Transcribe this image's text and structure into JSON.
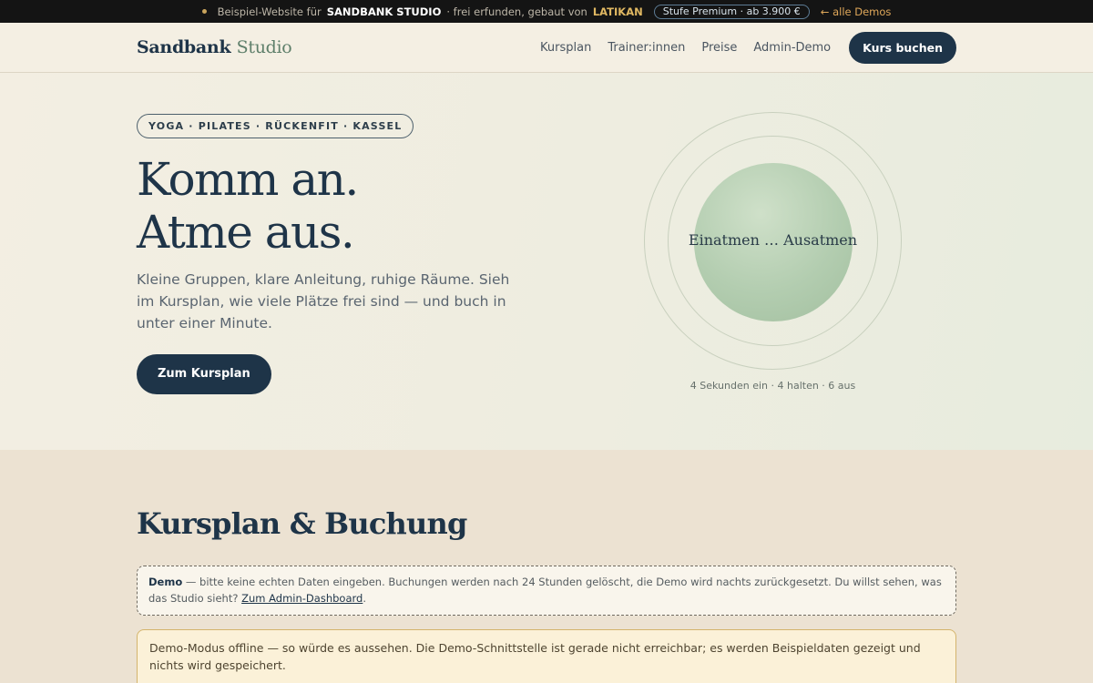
{
  "demobar": {
    "prefix": "Beispiel-Website für",
    "studio": "SANDBANK STUDIO",
    "middle": "· frei erfunden, gebaut von",
    "builder": "LATIKAN",
    "tier": "Stufe Premium · ab 3.900 €",
    "back": "← alle Demos"
  },
  "header": {
    "logo_main": "Sandbank",
    "logo_accent": "Studio",
    "nav": [
      "Kursplan",
      "Trainer:innen",
      "Preise",
      "Admin-Demo"
    ],
    "cta": "Kurs buchen"
  },
  "hero": {
    "chip": "YOGA · PILATES · RÜCKENFIT · KASSEL",
    "title_line1": "Komm an.",
    "title_line2": "Atme aus.",
    "lead": "Kleine Gruppen, klare Anleitung, ruhige Räume. Sieh im Kursplan, wie viele Plätze frei sind — und buch in unter einer Minute.",
    "button": "Zum Kursplan",
    "orb_label": "Einatmen … Ausatmen",
    "breath_note": "4 Sekunden ein · 4 halten · 6 aus"
  },
  "schedule": {
    "title": "Kursplan & Buchung",
    "notice_label": "Demo",
    "notice_text": "— bitte keine echten Daten eingeben. Buchungen werden nach 24 Stunden gelöscht, die Demo wird nachts zurückgesetzt. Du willst sehen, was das Studio sieht?",
    "notice_link": "Zum Admin-Dashboard",
    "notice_end": ".",
    "offline_text": "Demo-Modus offline — so würde es aussehen. Die Demo-Schnittstelle ist gerade nicht erreichbar; es werden Beispieldaten gezeigt und nichts wird gespeichert."
  },
  "colors": {
    "navy": "#1e3448",
    "sage": "#b3cdb0",
    "cream": "#f4efe3",
    "sand": "#ece2d2",
    "gold": "#e0b862"
  }
}
